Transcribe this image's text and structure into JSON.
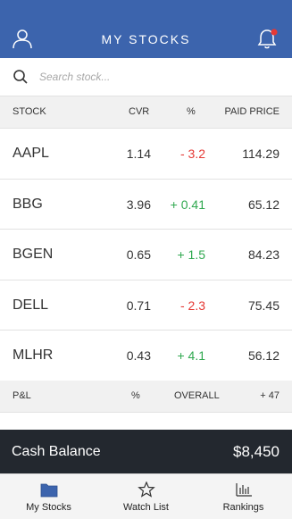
{
  "header": {
    "title": "MY STOCKS",
    "user_icon": "user-icon",
    "bell_icon": "bell-icon",
    "notification_dot_color": "#e53935",
    "bg_color": "#3c64ad"
  },
  "search": {
    "placeholder": "Search stock..."
  },
  "table": {
    "columns": {
      "stock": "STOCK",
      "cvr": "CVR",
      "pct": "%",
      "paid": "PAID PRICE"
    },
    "rows": [
      {
        "symbol": "AAPL",
        "cvr": "1.14",
        "pct": "- 3.2",
        "paid": "114.29",
        "trend": "down"
      },
      {
        "symbol": "BBG",
        "cvr": "3.96",
        "pct": "+ 0.41",
        "paid": "65.12",
        "trend": "up"
      },
      {
        "symbol": "BGEN",
        "cvr": "0.65",
        "pct": "+ 1.5",
        "paid": "84.23",
        "trend": "up"
      },
      {
        "symbol": "DELL",
        "cvr": "0.71",
        "pct": "- 2.3",
        "paid": "75.45",
        "trend": "down"
      },
      {
        "symbol": "MLHR",
        "cvr": "0.43",
        "pct": "+ 4.1",
        "paid": "56.12",
        "trend": "up"
      }
    ],
    "colors": {
      "up": "#2fa84f",
      "down": "#e53935"
    }
  },
  "summary": {
    "pl": "P&L",
    "pct": "%",
    "overall": "OVERALL",
    "value": "+ 47"
  },
  "cash": {
    "label": "Cash Balance",
    "value": "$8,450"
  },
  "tabs": [
    {
      "label": "My Stocks",
      "icon": "folder-icon"
    },
    {
      "label": "Watch List",
      "icon": "star-icon"
    },
    {
      "label": "Rankings",
      "icon": "bar-chart-icon"
    }
  ]
}
